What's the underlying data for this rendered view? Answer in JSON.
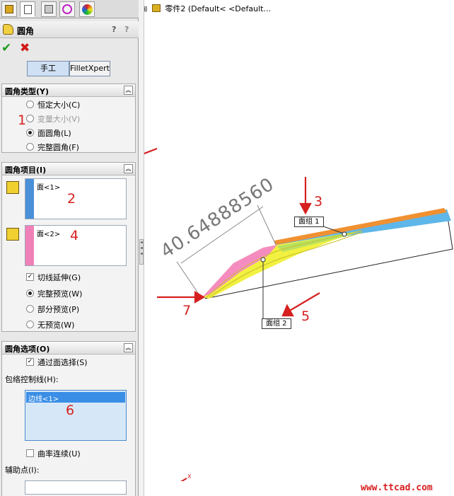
{
  "tree": {
    "expand_glyph": "⊞",
    "part_label": "零件2  (Default< <Default..."
  },
  "fm": {
    "title": "圆角",
    "help_glyph": "?",
    "ok_glyph": "✔",
    "cancel_glyph": "✖",
    "mode_manual": "手工",
    "mode_xpert": "FilletXpert"
  },
  "fillet_type": {
    "header": "圆角类型(Y)",
    "options": [
      "恒定大小(C)",
      "变量大小(V)",
      "面圆角(L)",
      "完整圆角(F)"
    ],
    "selected_index": 2
  },
  "fillet_items": {
    "header": "圆角项目(I)",
    "face1": "面<1>",
    "face2": "面<2>",
    "tangent": "切线延伸(G)",
    "preview_options": [
      "完整预览(W)",
      "部分预览(P)",
      "无预览(W)"
    ],
    "preview_selected": 0
  },
  "fillet_options": {
    "header": "圆角选项(O)",
    "select_through": "通过面选择(S)",
    "hold_line_label": "包络控制线(H):",
    "hold_line_item": "边线<1>",
    "curvature": "曲率连续(U)",
    "help_point_label": "辅助点(I):"
  },
  "viewport": {
    "dimension": "40.64888560",
    "face_set1": "面组 1",
    "face_set2": "面组 2",
    "axis_x": "X"
  },
  "annotations": [
    "1",
    "2",
    "3",
    "4",
    "5",
    "6",
    "7"
  ],
  "watermark": "www.ttcad.com",
  "colors": {
    "face1": "#4a90d9",
    "face2": "#f080b8",
    "fillet": "#f0f040",
    "edge": "#f09020",
    "annot": "#d62020"
  }
}
